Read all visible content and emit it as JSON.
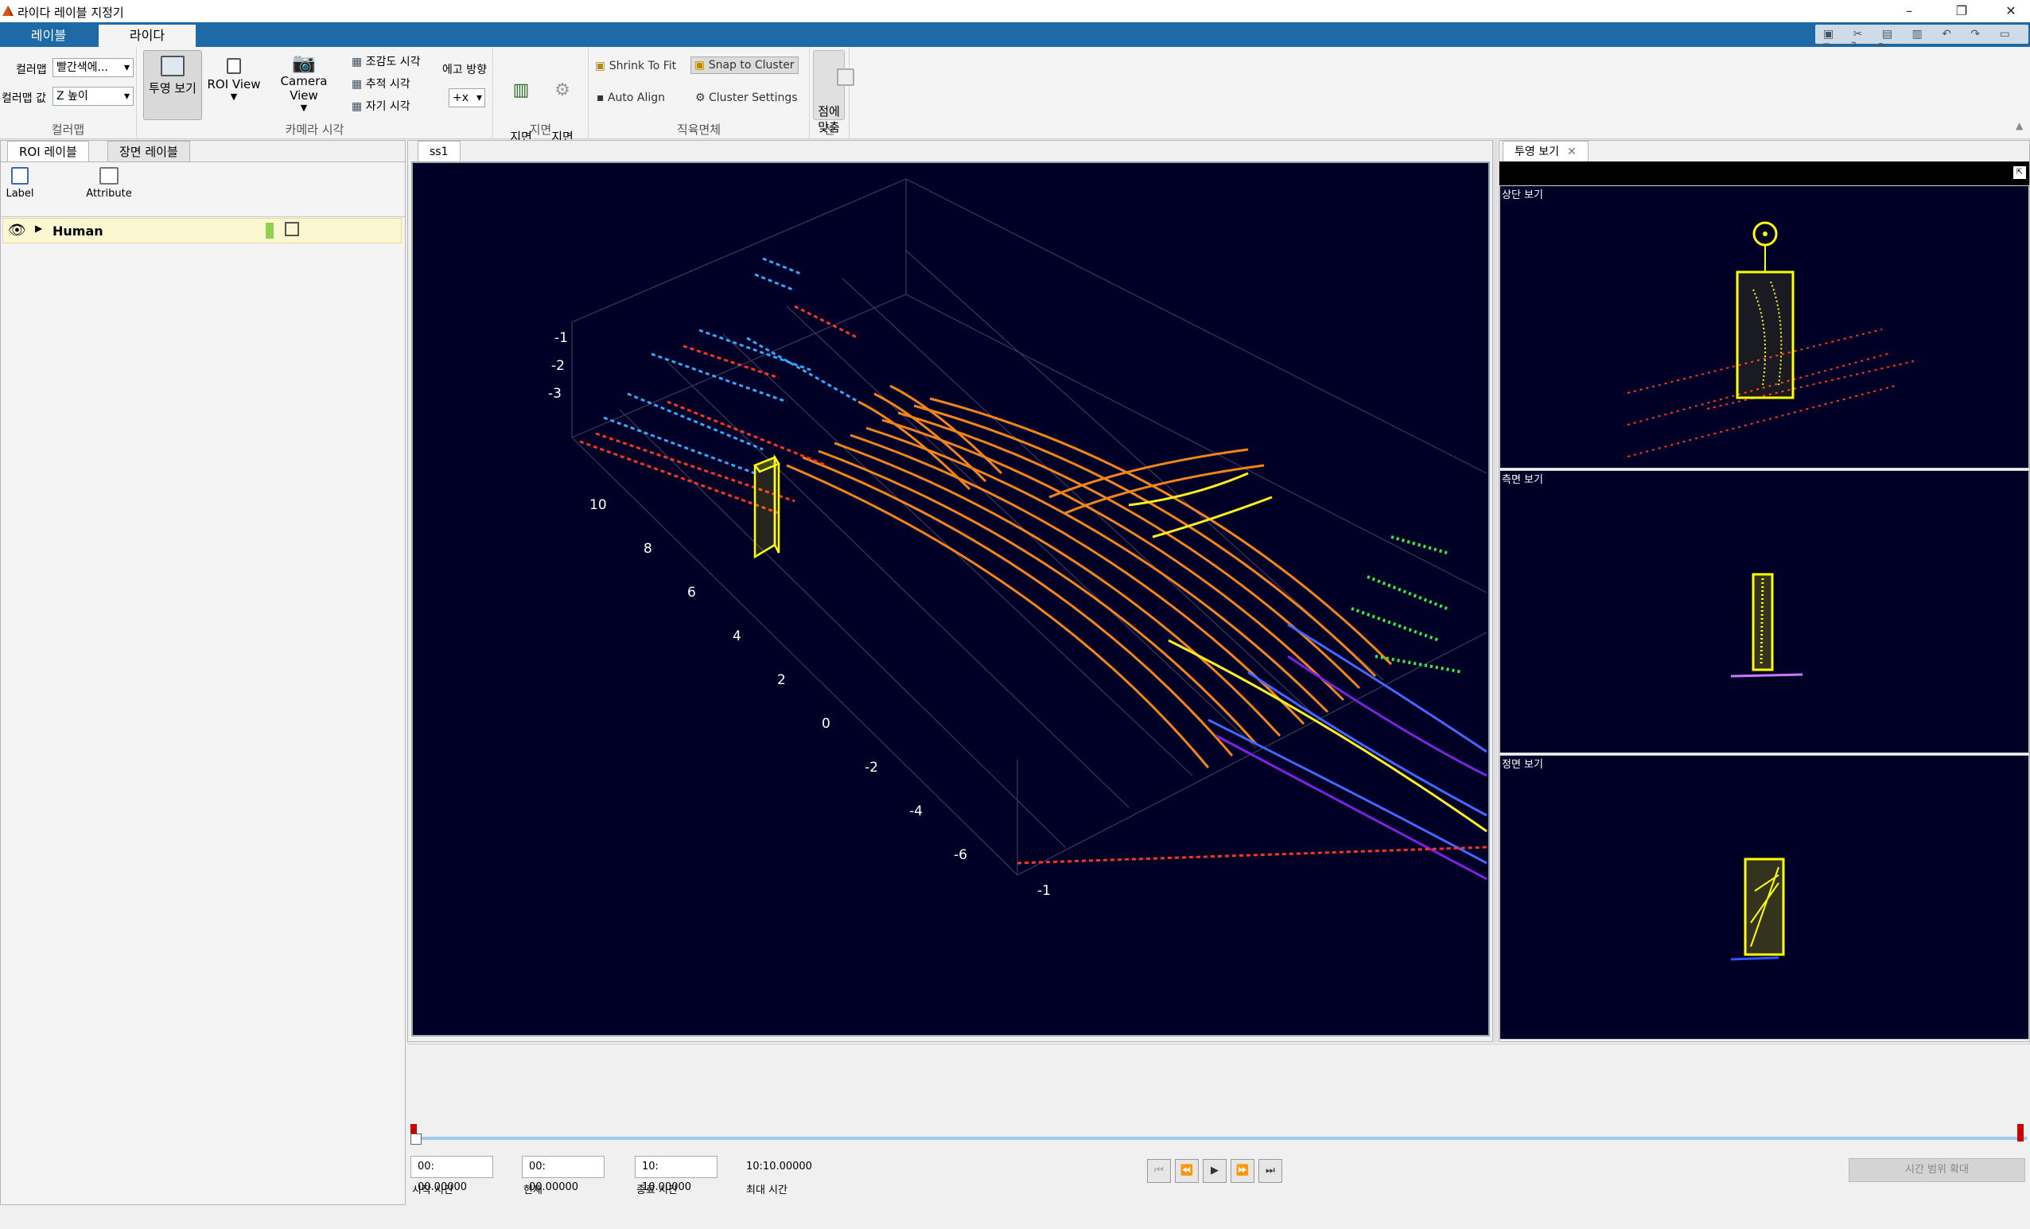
{
  "window": {
    "title": "라이다 레이블 지정기"
  },
  "ribbon_tabs": [
    "레이블",
    "라이다"
  ],
  "toolstrip": {
    "colormap_label": "컬러맵",
    "colormap_value": "빨간색에...",
    "colormap_value_label": "컬러맵 값",
    "colormap_value_value": "Z 높이",
    "colormap_group": "컬러맵",
    "projection_view": "투영 보기",
    "roi_view": "ROI View",
    "camera_view": "Camera View",
    "bird_view": "조감도 시각",
    "chase_view": "추적 시각",
    "ego_view": "자기 시각",
    "ego_direction_label": "에고 방향",
    "ego_direction_value": "+x",
    "camera_group": "카메라 시각",
    "hide_ground": "지면\n숨기기",
    "ground_settings": "지면\n설정",
    "ground_group": "지면",
    "shrink_to_fit": "Shrink To Fit",
    "snap_to_cluster": "Snap to Cluster",
    "auto_align": "Auto Align",
    "cluster_settings": "Cluster Settings",
    "cuboid_group": "직육면체",
    "fit_points": "점에\n맞춤",
    "line_group": "선"
  },
  "left_panel": {
    "tabs": [
      "ROI 레이블",
      "장면 레이블"
    ],
    "label_button": "Label",
    "attribute_button": "Attribute",
    "labels": [
      {
        "name": "Human",
        "color": "#8fd14f"
      }
    ]
  },
  "center_panel": {
    "tab": "ss1",
    "y_ticks": [
      "-1",
      "-2",
      "-3"
    ],
    "x_ticks": [
      "10",
      "8",
      "6",
      "4",
      "2",
      "0",
      "-2",
      "-4",
      "-6",
      "-1"
    ]
  },
  "right_panel": {
    "tab": "투영 보기",
    "views": [
      "상단 보기",
      "측면 보기",
      "정면 보기"
    ]
  },
  "timeline": {
    "start_value": "00:   00.00000",
    "start_label": "시작 시간",
    "current_value": "00:   00.00000",
    "current_label": "현재",
    "end_value": "10:   10.00000",
    "end_label": "종료 시간",
    "max_value": "10:10.00000",
    "max_label": "최대 시간",
    "zoom_button": "시간 범위 확대"
  },
  "colors": {
    "accent": "#1d6aa6",
    "plot_bg": "#000026",
    "cuboid": "#ffff00"
  }
}
